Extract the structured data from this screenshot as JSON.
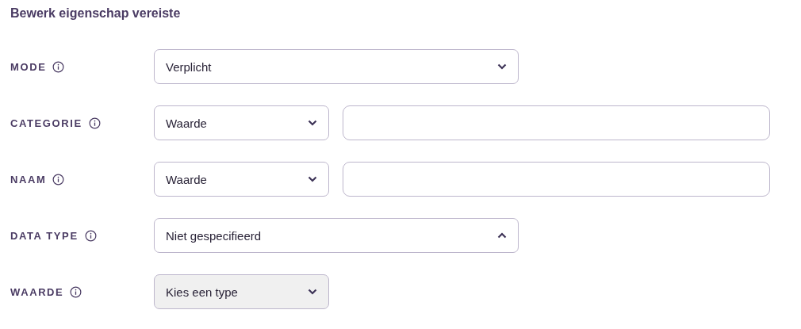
{
  "title": "Bewerk eigenschap vereiste",
  "rows": [
    {
      "label": "MODE",
      "controls": [
        {
          "kind": "select",
          "value": "Verplicht",
          "expanded": false,
          "disabled": false
        }
      ]
    },
    {
      "label": "CATEGORIE",
      "controls": [
        {
          "kind": "short-select",
          "value": "Waarde",
          "expanded": false,
          "disabled": false
        },
        {
          "kind": "text"
        }
      ]
    },
    {
      "label": "NAAM",
      "controls": [
        {
          "kind": "short-select",
          "value": "Waarde",
          "expanded": false,
          "disabled": false
        },
        {
          "kind": "text"
        }
      ]
    },
    {
      "label": "DATA TYPE",
      "controls": [
        {
          "kind": "select",
          "value": "Niet gespecifieerd",
          "expanded": true,
          "disabled": false
        }
      ]
    },
    {
      "label": "WAARDE",
      "controls": [
        {
          "kind": "short-select",
          "value": "Kies een type",
          "expanded": false,
          "disabled": true
        }
      ]
    }
  ]
}
